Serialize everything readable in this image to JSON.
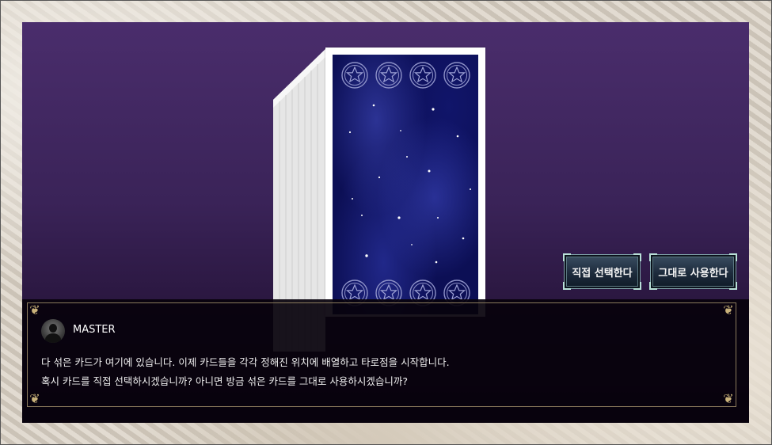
{
  "dialog": {
    "speaker": "MASTER",
    "lines": [
      "다 섞은 카드가 여기에 있습니다. 이제 카드들을 각각 정해진 위치에 배열하고 타로점을 시작합니다.",
      "혹시 카드를 직접 선택하시겠습니까? 아니면 방금 섞은 카드를 그대로 사용하시겠습니까?"
    ]
  },
  "choices": {
    "select_directly": "직접 선택한다",
    "use_as_is": "그대로 사용한다"
  },
  "colors": {
    "window_top": "#4a2d6c",
    "card_back": "#0c0f55",
    "button": "#1d2b3c",
    "dialog_border": "#8a7a5c"
  },
  "icons": [
    "star-emblem-icon",
    "avatar-silhouette-icon",
    "ornament-corner-icon"
  ]
}
